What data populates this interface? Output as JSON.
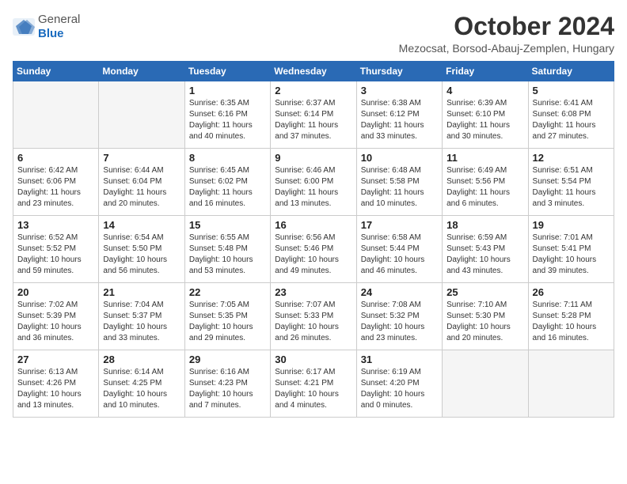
{
  "logo": {
    "general": "General",
    "blue": "Blue"
  },
  "title": "October 2024",
  "subtitle": "Mezocsat, Borsod-Abauj-Zemplen, Hungary",
  "headers": [
    "Sunday",
    "Monday",
    "Tuesday",
    "Wednesday",
    "Thursday",
    "Friday",
    "Saturday"
  ],
  "weeks": [
    [
      {
        "num": "",
        "info": ""
      },
      {
        "num": "",
        "info": ""
      },
      {
        "num": "1",
        "info": "Sunrise: 6:35 AM\nSunset: 6:16 PM\nDaylight: 11 hours and 40 minutes."
      },
      {
        "num": "2",
        "info": "Sunrise: 6:37 AM\nSunset: 6:14 PM\nDaylight: 11 hours and 37 minutes."
      },
      {
        "num": "3",
        "info": "Sunrise: 6:38 AM\nSunset: 6:12 PM\nDaylight: 11 hours and 33 minutes."
      },
      {
        "num": "4",
        "info": "Sunrise: 6:39 AM\nSunset: 6:10 PM\nDaylight: 11 hours and 30 minutes."
      },
      {
        "num": "5",
        "info": "Sunrise: 6:41 AM\nSunset: 6:08 PM\nDaylight: 11 hours and 27 minutes."
      }
    ],
    [
      {
        "num": "6",
        "info": "Sunrise: 6:42 AM\nSunset: 6:06 PM\nDaylight: 11 hours and 23 minutes."
      },
      {
        "num": "7",
        "info": "Sunrise: 6:44 AM\nSunset: 6:04 PM\nDaylight: 11 hours and 20 minutes."
      },
      {
        "num": "8",
        "info": "Sunrise: 6:45 AM\nSunset: 6:02 PM\nDaylight: 11 hours and 16 minutes."
      },
      {
        "num": "9",
        "info": "Sunrise: 6:46 AM\nSunset: 6:00 PM\nDaylight: 11 hours and 13 minutes."
      },
      {
        "num": "10",
        "info": "Sunrise: 6:48 AM\nSunset: 5:58 PM\nDaylight: 11 hours and 10 minutes."
      },
      {
        "num": "11",
        "info": "Sunrise: 6:49 AM\nSunset: 5:56 PM\nDaylight: 11 hours and 6 minutes."
      },
      {
        "num": "12",
        "info": "Sunrise: 6:51 AM\nSunset: 5:54 PM\nDaylight: 11 hours and 3 minutes."
      }
    ],
    [
      {
        "num": "13",
        "info": "Sunrise: 6:52 AM\nSunset: 5:52 PM\nDaylight: 10 hours and 59 minutes."
      },
      {
        "num": "14",
        "info": "Sunrise: 6:54 AM\nSunset: 5:50 PM\nDaylight: 10 hours and 56 minutes."
      },
      {
        "num": "15",
        "info": "Sunrise: 6:55 AM\nSunset: 5:48 PM\nDaylight: 10 hours and 53 minutes."
      },
      {
        "num": "16",
        "info": "Sunrise: 6:56 AM\nSunset: 5:46 PM\nDaylight: 10 hours and 49 minutes."
      },
      {
        "num": "17",
        "info": "Sunrise: 6:58 AM\nSunset: 5:44 PM\nDaylight: 10 hours and 46 minutes."
      },
      {
        "num": "18",
        "info": "Sunrise: 6:59 AM\nSunset: 5:43 PM\nDaylight: 10 hours and 43 minutes."
      },
      {
        "num": "19",
        "info": "Sunrise: 7:01 AM\nSunset: 5:41 PM\nDaylight: 10 hours and 39 minutes."
      }
    ],
    [
      {
        "num": "20",
        "info": "Sunrise: 7:02 AM\nSunset: 5:39 PM\nDaylight: 10 hours and 36 minutes."
      },
      {
        "num": "21",
        "info": "Sunrise: 7:04 AM\nSunset: 5:37 PM\nDaylight: 10 hours and 33 minutes."
      },
      {
        "num": "22",
        "info": "Sunrise: 7:05 AM\nSunset: 5:35 PM\nDaylight: 10 hours and 29 minutes."
      },
      {
        "num": "23",
        "info": "Sunrise: 7:07 AM\nSunset: 5:33 PM\nDaylight: 10 hours and 26 minutes."
      },
      {
        "num": "24",
        "info": "Sunrise: 7:08 AM\nSunset: 5:32 PM\nDaylight: 10 hours and 23 minutes."
      },
      {
        "num": "25",
        "info": "Sunrise: 7:10 AM\nSunset: 5:30 PM\nDaylight: 10 hours and 20 minutes."
      },
      {
        "num": "26",
        "info": "Sunrise: 7:11 AM\nSunset: 5:28 PM\nDaylight: 10 hours and 16 minutes."
      }
    ],
    [
      {
        "num": "27",
        "info": "Sunrise: 6:13 AM\nSunset: 4:26 PM\nDaylight: 10 hours and 13 minutes."
      },
      {
        "num": "28",
        "info": "Sunrise: 6:14 AM\nSunset: 4:25 PM\nDaylight: 10 hours and 10 minutes."
      },
      {
        "num": "29",
        "info": "Sunrise: 6:16 AM\nSunset: 4:23 PM\nDaylight: 10 hours and 7 minutes."
      },
      {
        "num": "30",
        "info": "Sunrise: 6:17 AM\nSunset: 4:21 PM\nDaylight: 10 hours and 4 minutes."
      },
      {
        "num": "31",
        "info": "Sunrise: 6:19 AM\nSunset: 4:20 PM\nDaylight: 10 hours and 0 minutes."
      },
      {
        "num": "",
        "info": ""
      },
      {
        "num": "",
        "info": ""
      }
    ]
  ]
}
